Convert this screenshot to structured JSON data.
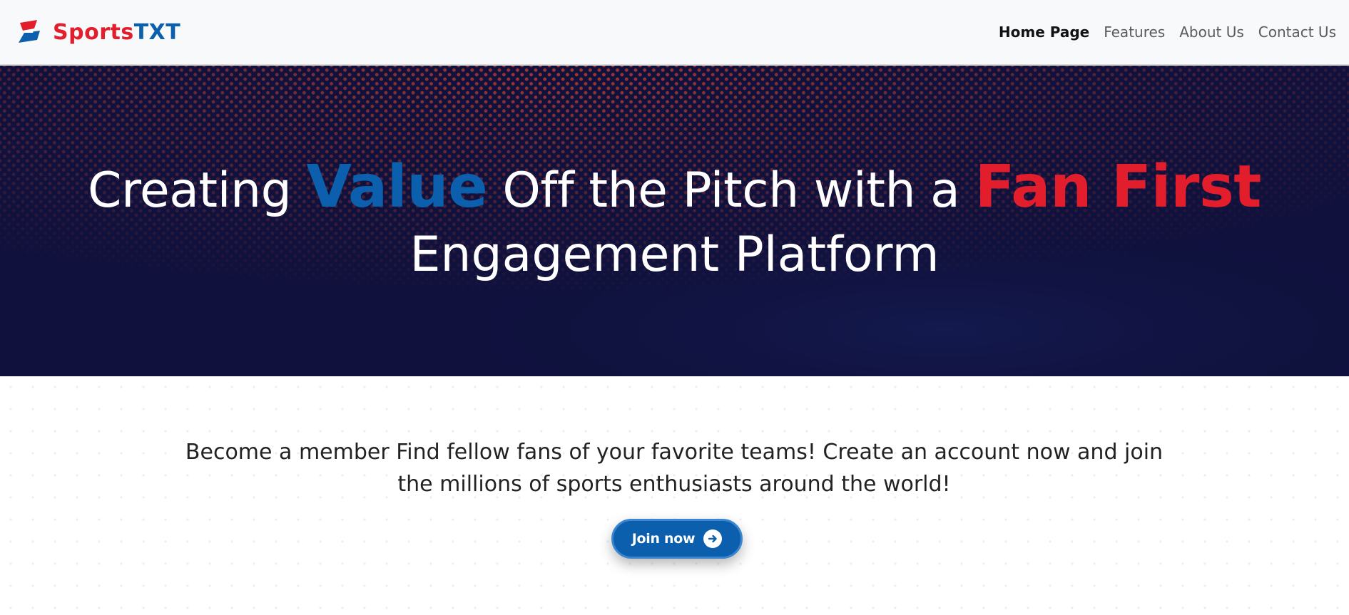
{
  "brand": {
    "name_part1": "Sports",
    "name_part2": "TXT",
    "logo_icon": "bolt-flag-icon"
  },
  "nav": {
    "items": [
      {
        "label": "Home Page",
        "active": true
      },
      {
        "label": "Features",
        "active": false
      },
      {
        "label": "About Us",
        "active": false
      },
      {
        "label": "Contact Us",
        "active": false
      }
    ]
  },
  "hero": {
    "title_part1": "Creating ",
    "title_highlight1": "Value",
    "title_part2": " Off the Pitch with a ",
    "title_highlight2": "Fan First",
    "title_line2": "Engagement Platform"
  },
  "cta": {
    "text": "Become a member Find fellow fans of your favorite teams! Create an account now and join the millions of sports enthusiasts around the world!",
    "button_label": "Join now",
    "button_icon": "arrow-right-circle-icon"
  },
  "colors": {
    "brand_red": "#e21d2c",
    "brand_blue": "#0b5fad",
    "hero_background": "#10113d",
    "hero_dot_pattern": "#c2412a"
  }
}
